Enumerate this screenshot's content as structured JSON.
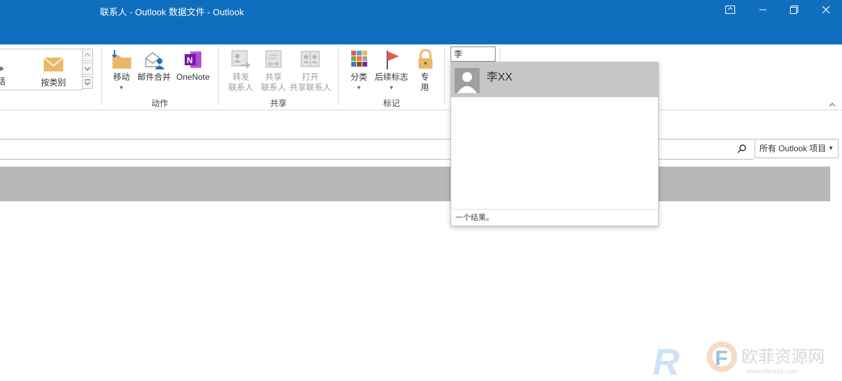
{
  "window": {
    "title": "联系人 - Outlook 数据文件  -  Outlook"
  },
  "ribbon": {
    "gallery": {
      "partial_label": "话",
      "by_category_label": "按类别"
    },
    "actions": {
      "move": "移动",
      "mail_merge": "邮件合并",
      "onenote": "OneNote",
      "group_label": "动作"
    },
    "share": {
      "forward_contact": "转发\n联系人",
      "share_contact": "共享\n联系人",
      "open_shared": "打开\n共享联系人",
      "group_label": "共享"
    },
    "tags": {
      "categorize": "分类",
      "follow_up": "后续标志",
      "private": "专\n用",
      "group_label": "标记"
    }
  },
  "search": {
    "query": "李",
    "scope": "所有 Outlook 项目",
    "results": [
      {
        "name": "李XX"
      }
    ],
    "result_count_text": "一个结果。"
  },
  "colors": {
    "title_bar": "#106ebe",
    "result_highlight": "#c6c6c6",
    "band": "#b8b8b8"
  }
}
